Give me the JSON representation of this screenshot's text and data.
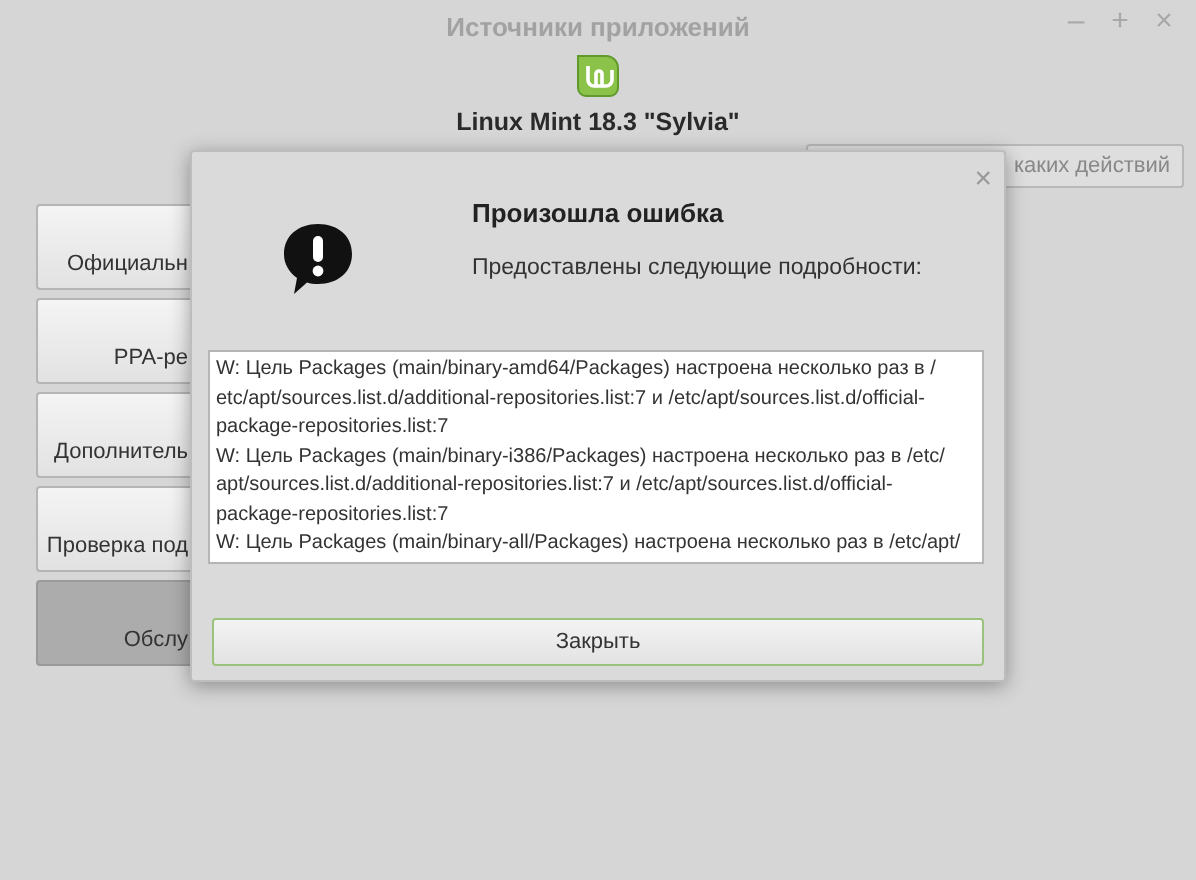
{
  "window": {
    "title": "Источники приложений",
    "controls": [
      "–",
      "+",
      "×"
    ]
  },
  "header": {
    "release": "Linux Mint 18.3 \"Sylvia\""
  },
  "top_button": {
    "label": "каких действий"
  },
  "sidebar": {
    "items": [
      {
        "label": "Официальн",
        "selected": false
      },
      {
        "label": "PPA-ре",
        "selected": false
      },
      {
        "label": "Дополнитель",
        "selected": false
      },
      {
        "label": "Проверка под",
        "selected": false
      },
      {
        "label": "Обслу",
        "selected": true
      }
    ]
  },
  "dialog": {
    "close": "×",
    "title": "Произошла ошибка",
    "subtitle": "Предоставлены следующие подробности:",
    "details": [
      "W: Цель Packages (main/binary-amd64/Packages) настроена несколько раз в /",
      "etc/apt/sources.list.d/additional-repositories.list:7 и /etc/apt/sources.list.d/official-",
      "package-repositories.list:7",
      "W: Цель Packages (main/binary-i386/Packages) настроена несколько раз в /etc/",
      "apt/sources.list.d/additional-repositories.list:7 и /etc/apt/sources.list.d/official-",
      "package-repositories.list:7",
      "W: Цель Packages (main/binary-all/Packages) настроена несколько раз в /etc/apt/"
    ],
    "button": "Закрыть"
  }
}
